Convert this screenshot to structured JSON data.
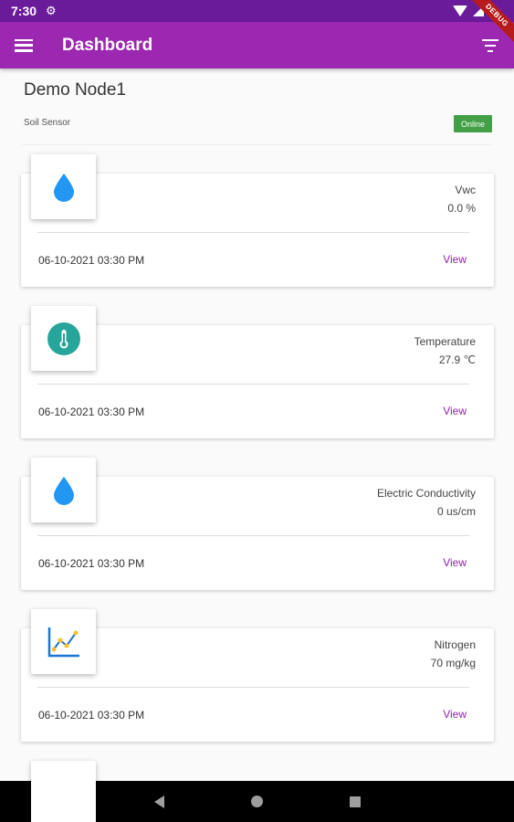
{
  "status_bar": {
    "time": "7:30",
    "gear_icon": "gear-icon",
    "debug_label": "DEBUG"
  },
  "app_bar": {
    "title": "Dashboard",
    "menu_icon": "menu-icon",
    "filter_icon": "filter-icon"
  },
  "node": {
    "name": "Demo Node1",
    "type": "Soil Sensor",
    "status": "Online",
    "status_color": "#43a047"
  },
  "accent": "#9c27b0",
  "sensors": [
    {
      "label": "Vwc",
      "value": "0.0 %",
      "timestamp": "06-10-2021 03:30 PM",
      "view_label": "View",
      "icon": "water-drop-icon"
    },
    {
      "label": "Temperature",
      "value": "27.9 ℃",
      "timestamp": "06-10-2021 03:30 PM",
      "view_label": "View",
      "icon": "thermometer-icon"
    },
    {
      "label": "Electric Conductivity",
      "value": "0 us/cm",
      "timestamp": "06-10-2021 03:30 PM",
      "view_label": "View",
      "icon": "water-drop-icon"
    },
    {
      "label": "Nitrogen",
      "value": "70 mg/kg",
      "timestamp": "06-10-2021 03:30 PM",
      "view_label": "View",
      "icon": "line-chart-icon"
    }
  ]
}
